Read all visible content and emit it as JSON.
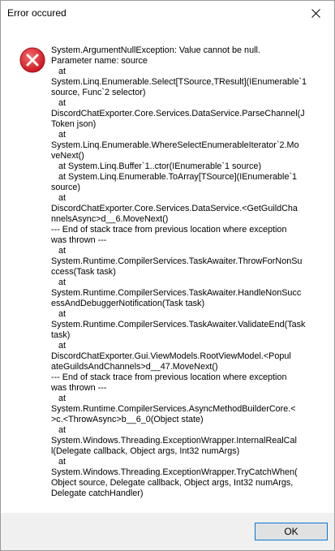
{
  "dialog": {
    "title": "Error occured",
    "icon": "error-icon",
    "message": "System.ArgumentNullException: Value cannot be null.\nParameter name: source\n   at\nSystem.Linq.Enumerable.Select[TSource,TResult](IEnumerable`1\nsource, Func`2 selector)\n   at\nDiscordChatExporter.Core.Services.DataService.ParseChannel(J\nToken json)\n   at\nSystem.Linq.Enumerable.WhereSelectEnumerableIterator`2.Mo\nveNext()\n   at System.Linq.Buffer`1..ctor(IEnumerable`1 source)\n   at System.Linq.Enumerable.ToArray[TSource](IEnumerable`1\nsource)\n   at\nDiscordChatExporter.Core.Services.DataService.<GetGuildCha\nnnelsAsync>d__6.MoveNext()\n--- End of stack trace from previous location where exception\nwas thrown ---\n   at\nSystem.Runtime.CompilerServices.TaskAwaiter.ThrowForNonSu\nccess(Task task)\n   at\nSystem.Runtime.CompilerServices.TaskAwaiter.HandleNonSucc\nessAndDebuggerNotification(Task task)\n   at\nSystem.Runtime.CompilerServices.TaskAwaiter.ValidateEnd(Task\ntask)\n   at\nDiscordChatExporter.Gui.ViewModels.RootViewModel.<Popul\nateGuildsAndChannels>d__47.MoveNext()\n--- End of stack trace from previous location where exception\nwas thrown ---\n   at\nSystem.Runtime.CompilerServices.AsyncMethodBuilderCore.<\n>c.<ThrowAsync>b__6_0(Object state)\n   at\nSystem.Windows.Threading.ExceptionWrapper.InternalRealCal\nl(Delegate callback, Object args, Int32 numArgs)\n   at\nSystem.Windows.Threading.ExceptionWrapper.TryCatchWhen(\nObject source, Delegate callback, Object args, Int32 numArgs,\nDelegate catchHandler)",
    "ok_label": "OK"
  },
  "colors": {
    "error_red": "#e81123",
    "button_border": "#0078d7",
    "footer_bg": "#f0f0f0"
  }
}
